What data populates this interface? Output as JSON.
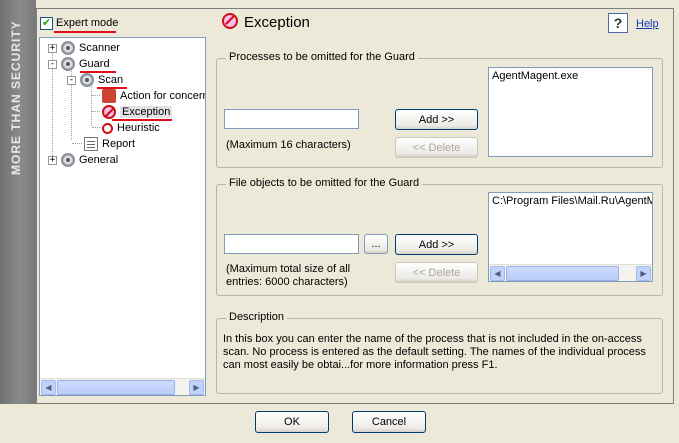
{
  "side_banner": "MORE THAN SECURITY",
  "left_panel": {
    "expert_mode_label": "Expert mode",
    "expert_mode_checked": true,
    "tree": [
      {
        "label": "Scanner",
        "level": 0,
        "expander": "+"
      },
      {
        "label": "Guard",
        "level": 0,
        "expander": "-"
      },
      {
        "label": "Scan",
        "level": 1,
        "expander": "-"
      },
      {
        "label": "Action for concern",
        "level": 2
      },
      {
        "label": "Exception",
        "level": 2,
        "selected": true
      },
      {
        "label": "Heuristic",
        "level": 2
      },
      {
        "label": "Report",
        "level": 1
      },
      {
        "label": "General",
        "level": 0,
        "expander": "+"
      }
    ]
  },
  "header": {
    "title": "Exception",
    "help_label": "Help",
    "help_icon": "?"
  },
  "processes_group": {
    "title": "Processes to be omitted for the Guard",
    "input_value": "",
    "hint": "(Maximum 16 characters)",
    "add_label": "Add >>",
    "delete_label": "<< Delete",
    "list_items": [
      "AgentMagent.exe"
    ]
  },
  "files_group": {
    "title": "File objects to be omitted for the Guard",
    "input_value": "",
    "browse_label": "...",
    "hint_line1": "(Maximum total size of all",
    "hint_line2": "entries: 6000 characters)",
    "add_label": "Add >>",
    "delete_label": "<< Delete",
    "list_items": [
      "C:\\Program Files\\Mail.Ru\\AgentM"
    ]
  },
  "description_group": {
    "title": "Description",
    "lines": [
      "In this box you can enter the name of the process that is not included in the on-access",
      "scan. No process is entered as the default setting. The names of the individual process",
      "can most easily be obtai...for more information press F1."
    ]
  },
  "footer": {
    "ok_label": "OK",
    "cancel_label": "Cancel"
  },
  "colors": {
    "accent_red": "#e0101a",
    "window_bg": "#ece9d8",
    "link": "#0b3bb7"
  }
}
